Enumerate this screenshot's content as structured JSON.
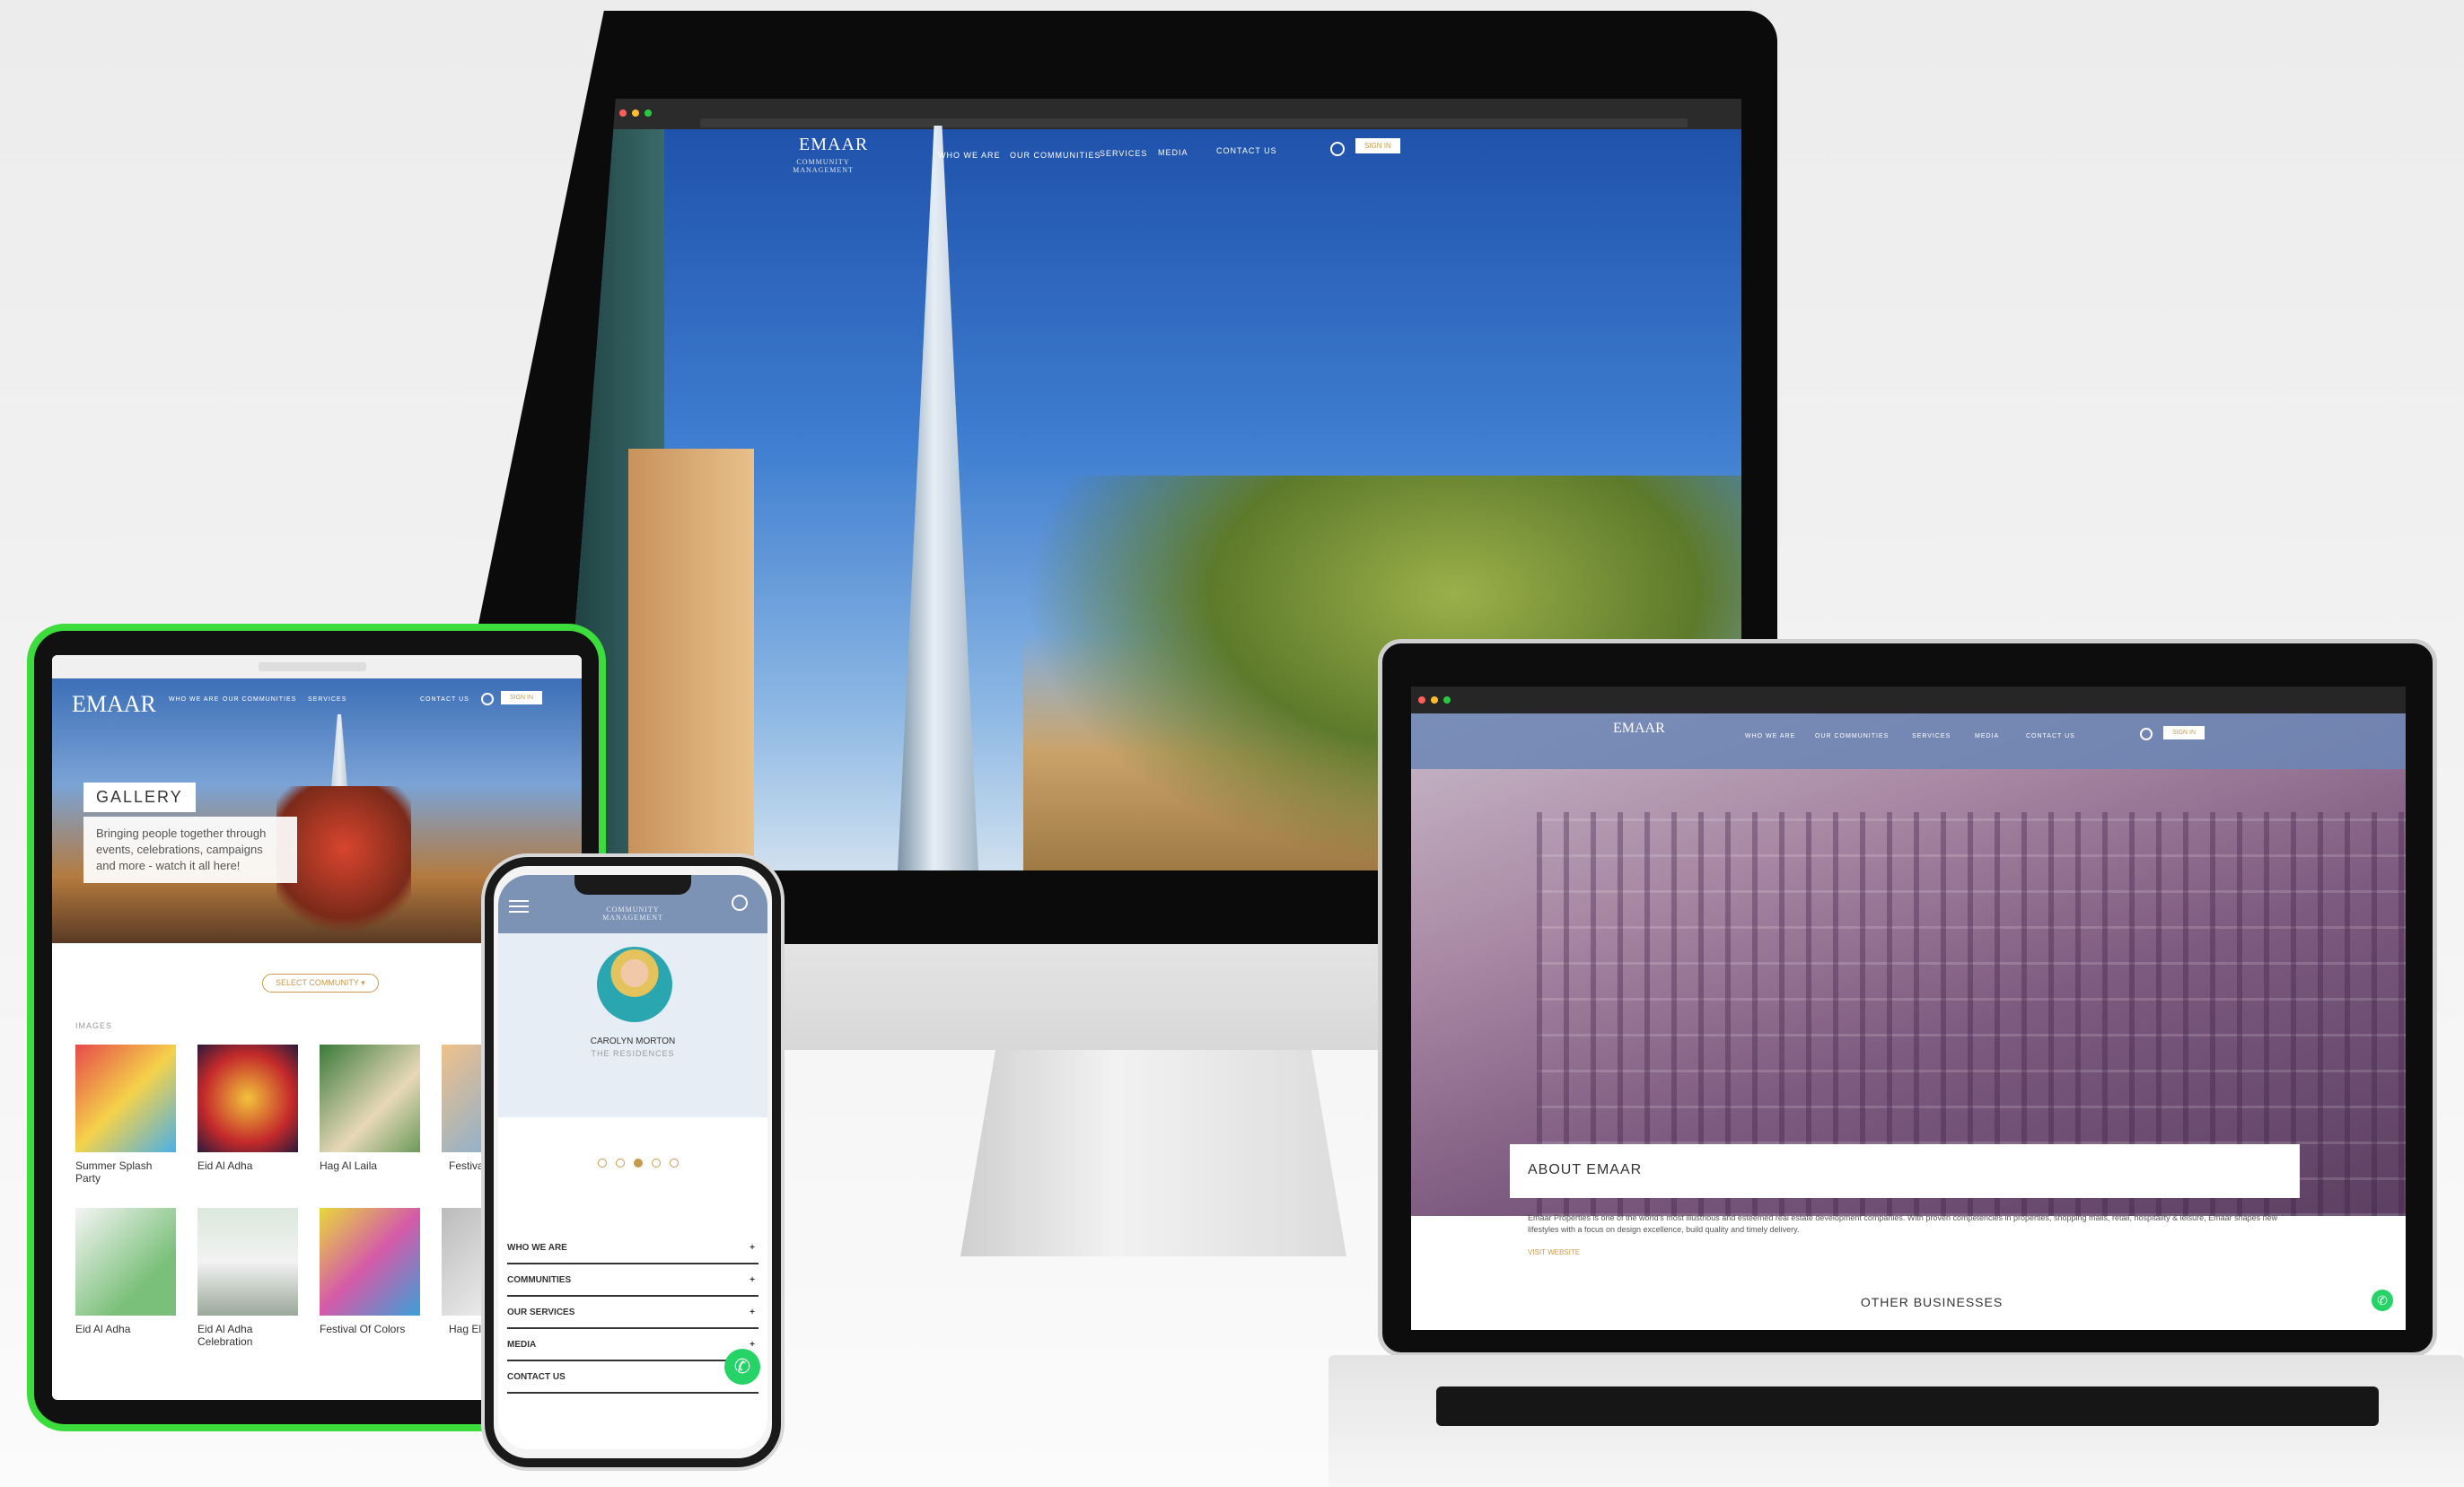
{
  "brand": {
    "logo": "EMAAR",
    "subtitle": "COMMUNITY MANAGEMENT",
    "accent": "#c49a4d"
  },
  "nav": {
    "items": [
      "WHO WE ARE",
      "OUR COMMUNITIES",
      "SERVICES",
      "MEDIA",
      "CONTACT US"
    ],
    "login": "SIGN IN",
    "search_icon": "search-icon"
  },
  "tablet": {
    "gallery_title": "GALLERY",
    "gallery_text": "Bringing people together through events, celebrations, campaigns and more - watch it all here!",
    "select_label": "SELECT COMMUNITY",
    "section_label": "IMAGES",
    "images": [
      {
        "caption": "Summer Splash Party"
      },
      {
        "caption": "Eid Al Adha"
      },
      {
        "caption": "Hag Al Laila"
      },
      {
        "caption": "Festiva"
      },
      {
        "caption": "Eid Al Adha"
      },
      {
        "caption": "Eid Al Adha Celebration"
      },
      {
        "caption": "Festival Of Colors"
      },
      {
        "caption": "Hag El"
      }
    ]
  },
  "phone": {
    "header_subtitle": "COMMUNITY MANAGEMENT",
    "person_name": "CAROLYN MORTON",
    "person_place": "THE RESIDENCES",
    "menu": [
      "WHO WE ARE",
      "COMMUNITIES",
      "OUR SERVICES",
      "MEDIA",
      "CONTACT US"
    ]
  },
  "laptop": {
    "about_title": "ABOUT EMAAR",
    "about_text": "Emaar Properties is one of the world's most illustrious and esteemed real estate development companies. With proven competencies in properties, shopping malls, retail, hospitality & leisure, Emaar shapes new lifestyles with a focus on design excellence, build quality and timely delivery.",
    "visit_link": "VISIT WEBSITE",
    "other_businesses": "OTHER BUSINESSES"
  },
  "colors": {
    "whatsapp": "#25d366",
    "tablet_frame": "#3ddc3d",
    "header_overlay": "#6b86b5"
  }
}
